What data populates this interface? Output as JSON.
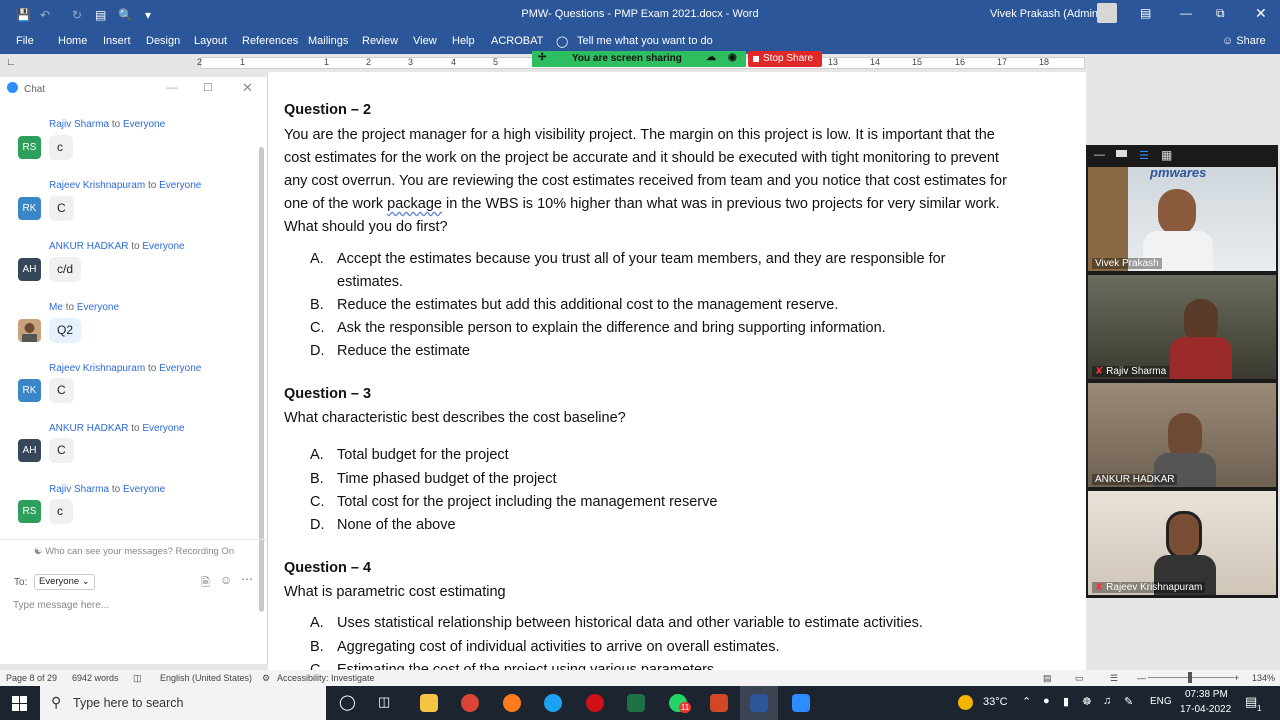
{
  "window": {
    "title": "PMW- Questions - PMP Exam 2021.docx  -  Word",
    "user": "Vivek Prakash (Admin)",
    "share_label": "Share"
  },
  "ribbon": {
    "tabs": [
      "File",
      "Home",
      "Insert",
      "Design",
      "Layout",
      "References",
      "Mailings",
      "Review",
      "View",
      "Help",
      "ACROBAT"
    ],
    "tell_me": "Tell me what you want to do"
  },
  "ruler": {
    "numbers": [
      "2",
      "1",
      "1",
      "2",
      "3",
      "4",
      "5",
      "13",
      "14",
      "15",
      "16",
      "17",
      "18"
    ]
  },
  "screen_share": {
    "status": "You are screen sharing",
    "stop_label": "Stop Share"
  },
  "document": {
    "q2": {
      "title": "Question – 2",
      "text_part1": "You are the project manager for a high visibility project. The margin on this project is low. It is important that the cost estimates for the work on the project be accurate and it should be executed with tight monitoring to prevent any cost overrun. You are reviewing the cost estimates received from team and you notice that cost estimates for one of the work ",
      "text_squiggle": "package",
      "text_part2": " in the WBS is 10% higher than what was in previous two projects for very similar work. What should you do first?",
      "options": [
        {
          "letter": "A.",
          "text": "Accept the estimates because you trust all of your team members, and they are responsible for estimates."
        },
        {
          "letter": "B.",
          "text": "Reduce the estimates but add this additional cost to the management reserve."
        },
        {
          "letter": "C.",
          "text": "Ask the responsible person to explain the difference and bring supporting information."
        },
        {
          "letter": "D.",
          "text": "Reduce the estimate"
        }
      ]
    },
    "q3": {
      "title": "Question – 3",
      "text": "What characteristic best describes the cost baseline?",
      "options": [
        {
          "letter": "A.",
          "text": "Total budget for the project"
        },
        {
          "letter": "B.",
          "text": "Time phased budget of the project"
        },
        {
          "letter": "C.",
          "text": "Total cost for the project including the management reserve"
        },
        {
          "letter": "D.",
          "text": "None of the above"
        }
      ]
    },
    "q4": {
      "title": "Question – 4",
      "text": "What is parametric cost estimating",
      "options": [
        {
          "letter": "A.",
          "text": "Uses statistical relationship between historical data and other variable to estimate activities."
        },
        {
          "letter": "B.",
          "text": "Aggregating cost of individual activities to arrive on overall estimates."
        },
        {
          "letter": "C.",
          "text": "Estimating the cost of the project using various parameters"
        }
      ]
    }
  },
  "chat": {
    "title": "Chat",
    "to_word": "to",
    "messages": [
      {
        "from": "Rajiv Sharma",
        "to": "Everyone",
        "initials": "RS",
        "color": "#2e9e5b",
        "text": "c"
      },
      {
        "from": "Rajeev Krishnapuram",
        "to": "Everyone",
        "initials": "RK",
        "color": "#3a86c8",
        "text": "C"
      },
      {
        "from": "ANKUR HADKAR",
        "to": "Everyone",
        "initials": "AH",
        "color": "#37475a",
        "text": "c/d"
      },
      {
        "from": "Me",
        "to": "Everyone",
        "initials": "",
        "color": "#c8a27a",
        "text": "Q2"
      },
      {
        "from": "Rajeev Krishnapuram",
        "to": "Everyone",
        "initials": "RK",
        "color": "#3a86c8",
        "text": "C"
      },
      {
        "from": "ANKUR HADKAR",
        "to": "Everyone",
        "initials": "AH",
        "color": "#37475a",
        "text": "C"
      },
      {
        "from": "Rajiv Sharma",
        "to": "Everyone",
        "initials": "RS",
        "color": "#2e9e5b",
        "text": "c"
      }
    ],
    "privacy": "Who can see your messages? Recording On",
    "to_label": "To:",
    "recipient": "Everyone",
    "input_placeholder": "Type message here..."
  },
  "videos": {
    "brand": "pmwares",
    "participants": [
      "Vivek Prakash",
      "Rajiv Sharma",
      "ANKUR HADKAR",
      "Rajeev Krishnapuram"
    ]
  },
  "statusbar": {
    "page": "Page 8 of 29",
    "words": "6942 words",
    "language": "English (United States)",
    "accessibility": "Accessibility: Investigate",
    "zoom": "134%"
  },
  "taskbar": {
    "search_placeholder": "Type here to search",
    "temperature": "33°C",
    "lang": "ENG",
    "time": "07:38 PM",
    "date": "17-04-2022",
    "whatsapp_badge": "11",
    "notif_count": "1"
  }
}
